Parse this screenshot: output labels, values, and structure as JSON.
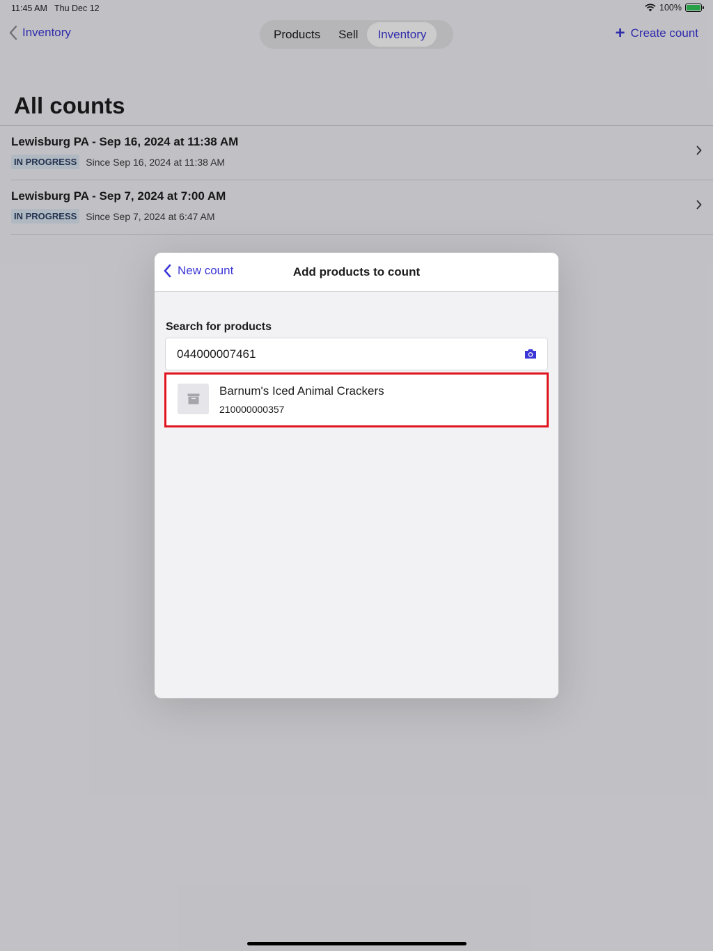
{
  "status_bar": {
    "time": "11:45 AM",
    "date": "Thu Dec 12",
    "battery": "100%"
  },
  "nav": {
    "back_label": "Inventory",
    "segments": [
      {
        "label": "Products",
        "active": false
      },
      {
        "label": "Sell",
        "active": false
      },
      {
        "label": "Inventory",
        "active": true
      }
    ],
    "create_label": "Create count"
  },
  "page": {
    "title": "All counts",
    "counts": [
      {
        "title": "Lewisburg PA - Sep 16, 2024 at 11:38 AM",
        "status": "IN PROGRESS",
        "since": "Since Sep 16, 2024 at 11:38 AM"
      },
      {
        "title": "Lewisburg PA - Sep 7, 2024 at 7:00 AM",
        "status": "IN PROGRESS",
        "since": "Since Sep 7, 2024 at 6:47 AM"
      }
    ]
  },
  "modal": {
    "back_label": "New count",
    "title": "Add products to count",
    "search_label": "Search for products",
    "search_value": "044000007461",
    "results": [
      {
        "name": "Barnum's Iced Animal Crackers",
        "code": "210000000357"
      }
    ]
  },
  "colors": {
    "accent": "#3b36d6",
    "highlight_border": "#e0141e",
    "badge_bg": "#dde6f2"
  },
  "icons": {
    "back": "chevron-left-icon",
    "add": "plus-icon",
    "row_disclosure": "chevron-right-icon",
    "search_camera": "camera-icon",
    "product_placeholder": "archive-box-icon",
    "wifi": "wifi-icon",
    "battery": "battery-charging-icon"
  }
}
